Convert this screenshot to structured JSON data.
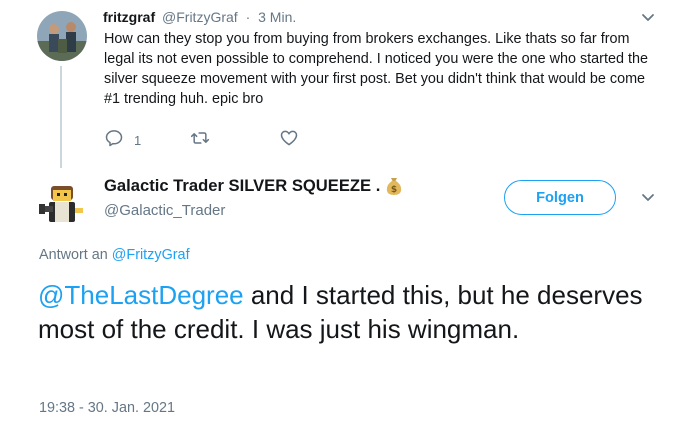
{
  "parent_tweet": {
    "display_name": "fritzgraf",
    "handle": "@FritzyGraf",
    "separator": "·",
    "time": "3 Min.",
    "text": "How can they stop you from buying from brokers exchanges. Like thats so far from legal its not even possible to comprehend.  I noticed you were the one who started the silver squeeze movement with your first post. Bet you didn't think that would be come #1 trending huh. epic bro",
    "reply_count": "1",
    "icons": [
      "reply-icon",
      "retweet-icon",
      "like-icon",
      "chevron-down-icon"
    ]
  },
  "main_tweet": {
    "display_name": "Galactic Trader SILVER SQUEEZE .",
    "name_emoji": "money-bag-icon",
    "handle": "@Galactic_Trader",
    "follow_label": "Folgen",
    "reply_prefix": "Antwort an",
    "reply_to_handle": "@FritzyGraf",
    "text_mention": "@TheLastDegree",
    "text_rest": " and I started this, but he deserves most of the credit. I was just his wingman.",
    "timestamp": "19:38 - 30. Jan. 2021"
  },
  "colors": {
    "accent": "#1da1f2",
    "text": "#14171a",
    "muted": "#657786",
    "thread_line": "#ccd6dd"
  }
}
